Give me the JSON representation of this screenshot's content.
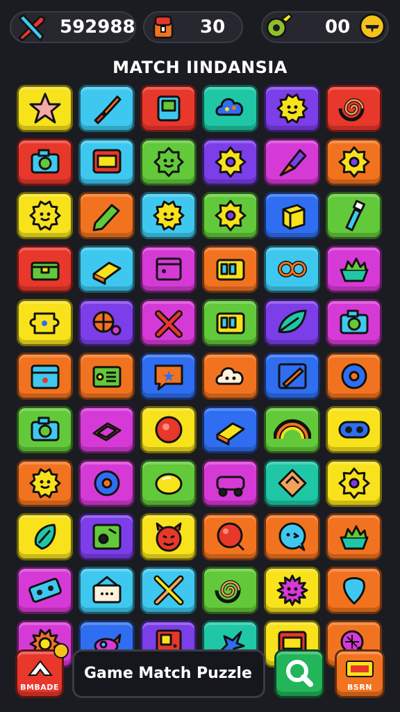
{
  "hud": {
    "score": {
      "value": "592988",
      "icon": "crossed-swords-icon"
    },
    "gems": {
      "value": "30",
      "icon": "treasure-chest-icon"
    },
    "keys": {
      "value": "00",
      "icon": "gear-key-icon",
      "add_icon": "plus-coin-icon"
    }
  },
  "title": "MATCH IINDANSIA",
  "colors": {
    "yellow": "#f7e21b",
    "cyan": "#3ec8ef",
    "red": "#e8372b",
    "teal": "#1fc7a6",
    "purple": "#7b3ee8",
    "orange": "#f2731f",
    "green": "#62c93a",
    "magenta": "#d63ad6",
    "blue": "#2f6ef0"
  },
  "board": {
    "rows": [
      [
        {
          "c": "yellow",
          "icon": "star-icon"
        },
        {
          "c": "cyan",
          "icon": "brush-icon"
        },
        {
          "c": "red",
          "icon": "device-icon"
        },
        {
          "c": "teal",
          "icon": "cloud-icon"
        },
        {
          "c": "purple",
          "icon": "sun-face-icon"
        },
        {
          "c": "red",
          "icon": "swirl-icon"
        }
      ],
      [
        {
          "c": "red",
          "icon": "camera-icon"
        },
        {
          "c": "cyan",
          "icon": "screen-icon"
        },
        {
          "c": "green",
          "icon": "gear-face-icon"
        },
        {
          "c": "purple",
          "icon": "gear-icon"
        },
        {
          "c": "magenta",
          "icon": "rocket-icon"
        },
        {
          "c": "orange",
          "icon": "gear-icon"
        }
      ],
      [
        {
          "c": "yellow",
          "icon": "sun-face-icon"
        },
        {
          "c": "orange",
          "icon": "pencil-icon"
        },
        {
          "c": "cyan",
          "icon": "sun-face-icon"
        },
        {
          "c": "green",
          "icon": "gear-icon"
        },
        {
          "c": "blue",
          "icon": "cube-icon"
        },
        {
          "c": "green",
          "icon": "bottle-icon"
        }
      ],
      [
        {
          "c": "red",
          "icon": "chest-icon"
        },
        {
          "c": "cyan",
          "icon": "book-icon"
        },
        {
          "c": "magenta",
          "icon": "box-icon"
        },
        {
          "c": "orange",
          "icon": "machine-icon"
        },
        {
          "c": "cyan",
          "icon": "knot-icon"
        },
        {
          "c": "magenta",
          "icon": "basket-icon"
        }
      ],
      [
        {
          "c": "yellow",
          "icon": "puzzle-icon"
        },
        {
          "c": "purple",
          "icon": "ball-icon"
        },
        {
          "c": "magenta",
          "icon": "cross-icon"
        },
        {
          "c": "green",
          "icon": "machine-icon"
        },
        {
          "c": "purple",
          "icon": "leaf-icon"
        },
        {
          "c": "magenta",
          "icon": "camera-icon"
        }
      ],
      [
        {
          "c": "orange",
          "icon": "calendar-icon"
        },
        {
          "c": "orange",
          "icon": "card-icon"
        },
        {
          "c": "blue",
          "icon": "chat-icon"
        },
        {
          "c": "orange",
          "icon": "cloud-face-icon"
        },
        {
          "c": "blue",
          "icon": "pencil-board-icon"
        },
        {
          "c": "orange",
          "icon": "donut-icon"
        }
      ],
      [
        {
          "c": "green",
          "icon": "camera-icon"
        },
        {
          "c": "magenta",
          "icon": "tray-icon"
        },
        {
          "c": "yellow",
          "icon": "button-icon"
        },
        {
          "c": "blue",
          "icon": "book-icon"
        },
        {
          "c": "green",
          "icon": "rainbow-icon"
        },
        {
          "c": "yellow",
          "icon": "pill-icon"
        }
      ],
      [
        {
          "c": "orange",
          "icon": "sun-face-icon"
        },
        {
          "c": "magenta",
          "icon": "donut-icon"
        },
        {
          "c": "green",
          "icon": "lemon-icon"
        },
        {
          "c": "magenta",
          "icon": "toy-car-icon"
        },
        {
          "c": "teal",
          "icon": "diamond-icon"
        },
        {
          "c": "yellow",
          "icon": "gear-icon"
        }
      ],
      [
        {
          "c": "yellow",
          "icon": "shield-icon"
        },
        {
          "c": "purple",
          "icon": "photo-icon"
        },
        {
          "c": "yellow",
          "icon": "devil-face-icon"
        },
        {
          "c": "orange",
          "icon": "balloon-icon"
        },
        {
          "c": "orange",
          "icon": "face-bubble-icon"
        },
        {
          "c": "orange",
          "icon": "basket-icon"
        }
      ],
      [
        {
          "c": "magenta",
          "icon": "tape-icon"
        },
        {
          "c": "cyan",
          "icon": "sign-icon"
        },
        {
          "c": "cyan",
          "icon": "tools-icon"
        },
        {
          "c": "green",
          "icon": "swirl-icon"
        },
        {
          "c": "yellow",
          "icon": "monster-icon"
        },
        {
          "c": "orange",
          "icon": "pick-icon"
        }
      ],
      [
        {
          "c": "magenta",
          "icon": "sun-icon"
        },
        {
          "c": "blue",
          "icon": "bird-icon"
        },
        {
          "c": "purple",
          "icon": "door-icon"
        },
        {
          "c": "teal",
          "icon": "splash-icon"
        },
        {
          "c": "yellow",
          "icon": "screen-icon"
        },
        {
          "c": "orange",
          "icon": "racket-icon"
        }
      ]
    ]
  },
  "bottom": {
    "left_button": {
      "label": "BMBADE",
      "icon": "arrow-up-icon",
      "badge_icon": "coin-badge-icon"
    },
    "name_box": "Game Match Puzzle",
    "search_button": {
      "icon": "search-icon"
    },
    "right_button": {
      "label": "BSRN",
      "icon": "ticket-icon"
    }
  }
}
